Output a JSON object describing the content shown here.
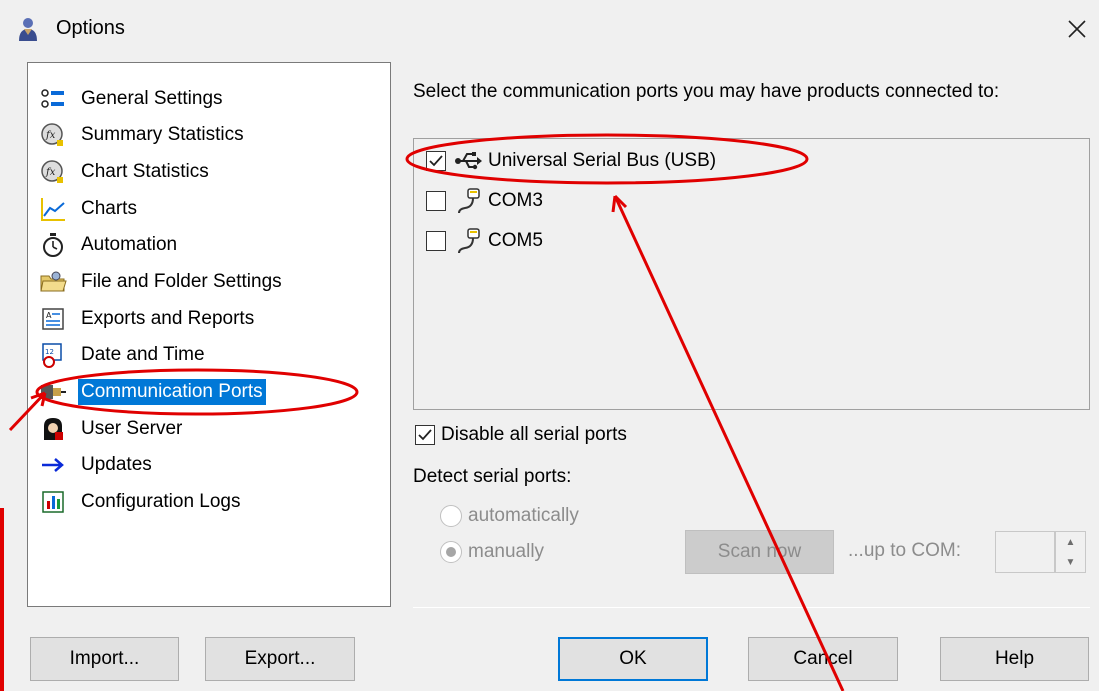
{
  "window": {
    "title": "Options",
    "icon": "app-person-icon",
    "close_icon": "close-icon"
  },
  "tree": {
    "items": [
      {
        "label": "General Settings",
        "icon": "general-settings-icon"
      },
      {
        "label": "Summary Statistics",
        "icon": "fx-statistics-icon"
      },
      {
        "label": "Chart Statistics",
        "icon": "fx-statistics-icon"
      },
      {
        "label": "Charts",
        "icon": "chart-line-icon"
      },
      {
        "label": "Automation",
        "icon": "stopwatch-icon"
      },
      {
        "label": "File and Folder Settings",
        "icon": "folder-icon"
      },
      {
        "label": "Exports and Reports",
        "icon": "report-icon"
      },
      {
        "label": "Date and Time",
        "icon": "calendar-clock-icon"
      },
      {
        "label": "Communication Ports",
        "icon": "port-cable-icon",
        "selected": true
      },
      {
        "label": "User Server",
        "icon": "user-server-icon"
      },
      {
        "label": "Updates",
        "icon": "arrow-right-icon"
      },
      {
        "label": "Configuration Logs",
        "icon": "log-chart-icon"
      }
    ]
  },
  "ports": {
    "heading": "Select the communication ports you may have products connected to:",
    "list": [
      {
        "label": "Universal Serial Bus (USB)",
        "checked": true,
        "icon": "usb-icon"
      },
      {
        "label": "COM3",
        "checked": false,
        "icon": "serial-cable-icon"
      },
      {
        "label": "COM5",
        "checked": false,
        "icon": "serial-cable-icon"
      }
    ],
    "disable_serial_label": "Disable all serial ports",
    "disable_serial_checked": true,
    "detect_label": "Detect serial ports:",
    "radio_automatic": "automatically",
    "radio_manual": "manually",
    "radio_selected": "manually",
    "scan_label": "Scan now",
    "upto_label": "...up to COM:",
    "upto_value": ""
  },
  "buttons": {
    "import": "Import...",
    "export": "Export...",
    "ok": "OK",
    "cancel": "Cancel",
    "help": "Help"
  },
  "colors": {
    "selection": "#0078d7",
    "annotation": "#e00000"
  }
}
